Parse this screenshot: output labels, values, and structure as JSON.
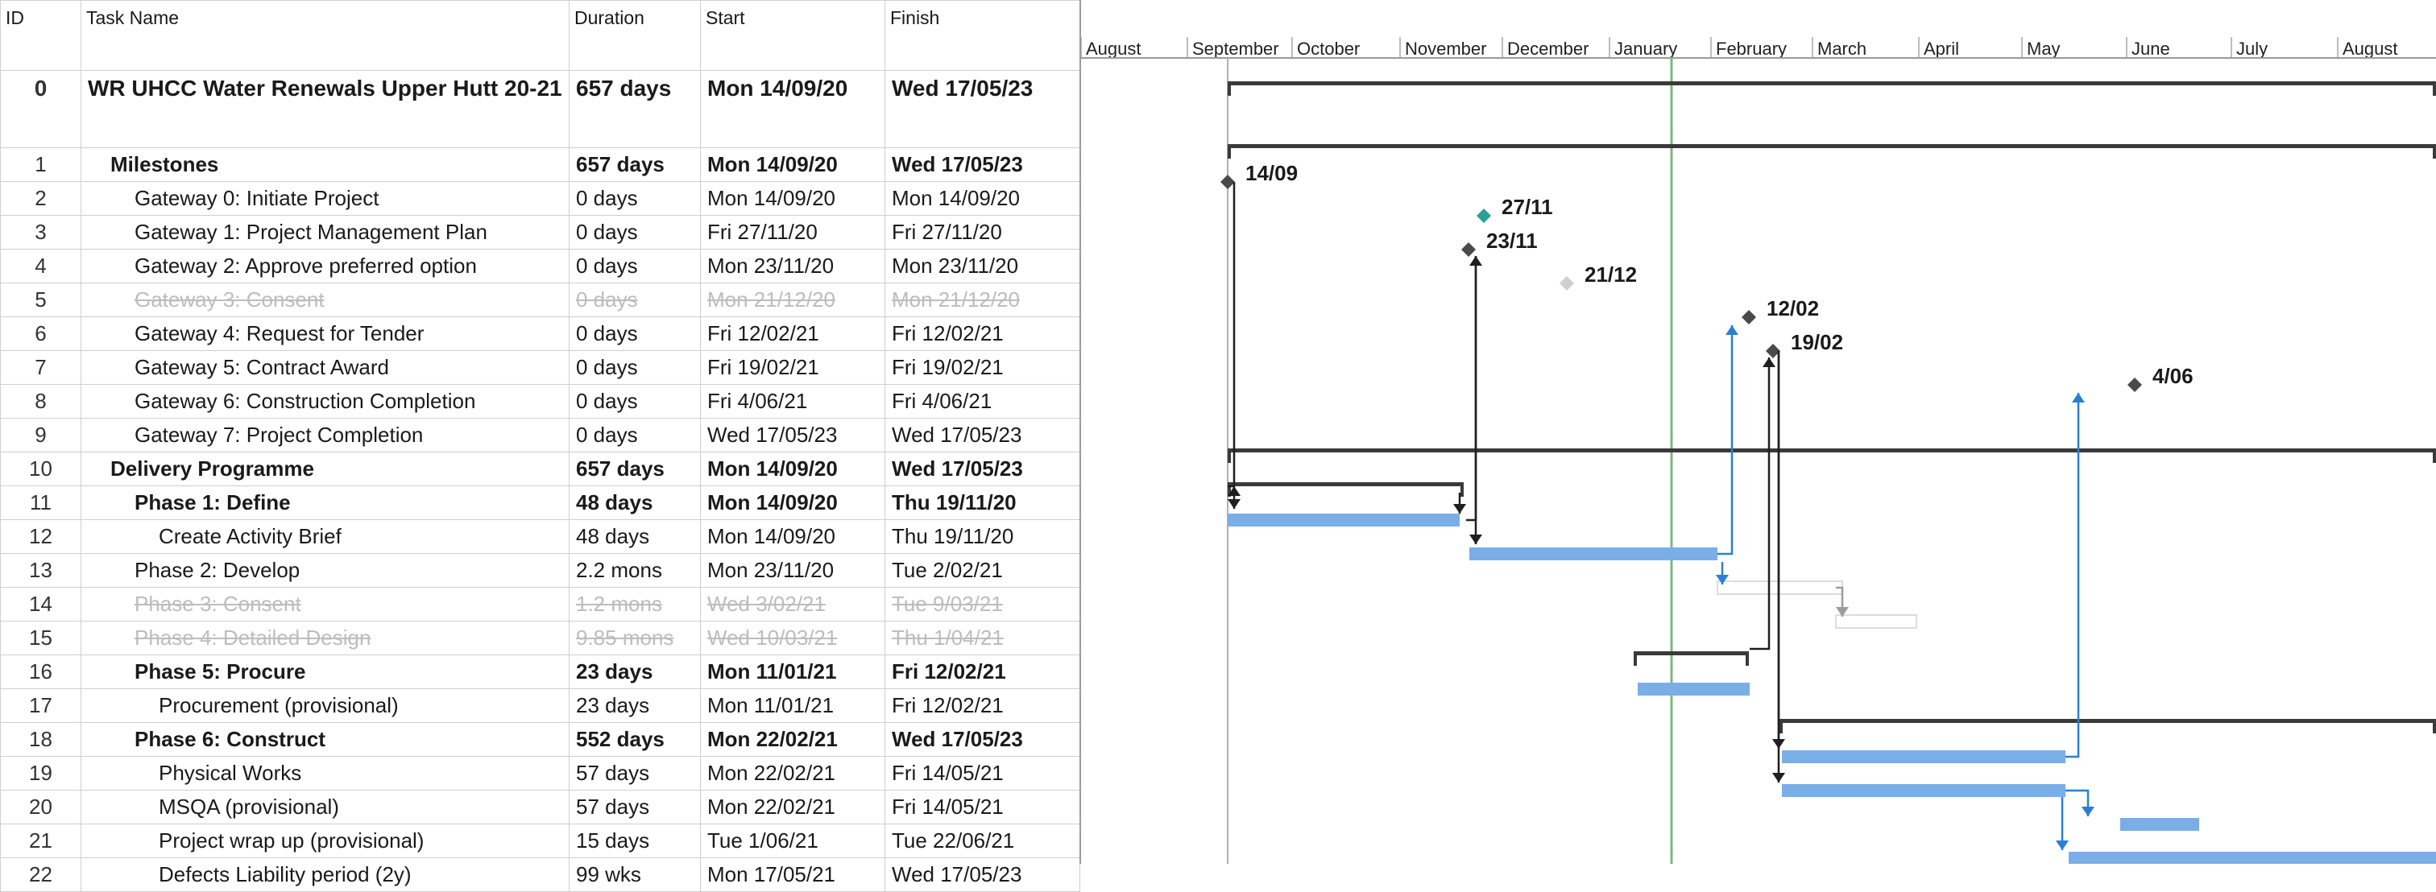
{
  "columns": {
    "id": "ID",
    "name": "Task Name",
    "duration": "Duration",
    "start": "Start",
    "finish": "Finish"
  },
  "timeline": {
    "months": [
      "August",
      "September",
      "October",
      "November",
      "December",
      "January",
      "February",
      "March",
      "April",
      "May",
      "June",
      "July",
      "August"
    ]
  },
  "tasks": [
    {
      "id": "0",
      "name": "WR UHCC Water Renewals Upper Hutt 20-21",
      "duration": "657 days",
      "start": "Mon 14/09/20",
      "finish": "Wed 17/05/23",
      "summary": true,
      "level": 0
    },
    {
      "id": "1",
      "name": "Milestones",
      "duration": "657 days",
      "start": "Mon 14/09/20",
      "finish": "Wed 17/05/23",
      "summary": true,
      "level": 1
    },
    {
      "id": "2",
      "name": "Gateway 0: Initiate Project",
      "duration": "0 days",
      "start": "Mon 14/09/20",
      "finish": "Mon 14/09/20",
      "level": 2,
      "milestone_label": "14/09"
    },
    {
      "id": "3",
      "name": "Gateway 1: Project Management Plan",
      "duration": "0 days",
      "start": "Fri 27/11/20",
      "finish": "Fri 27/11/20",
      "level": 2,
      "milestone_label": "27/11"
    },
    {
      "id": "4",
      "name": "Gateway 2: Approve preferred option",
      "duration": "0 days",
      "start": "Mon 23/11/20",
      "finish": "Mon 23/11/20",
      "level": 2,
      "milestone_label": "23/11"
    },
    {
      "id": "5",
      "name": "Gateway 3: Consent",
      "duration": "0 days",
      "start": "Mon 21/12/20",
      "finish": "Mon 21/12/20",
      "level": 2,
      "inactive": true,
      "milestone_label": "21/12"
    },
    {
      "id": "6",
      "name": "Gateway 4: Request for Tender",
      "duration": "0 days",
      "start": "Fri 12/02/21",
      "finish": "Fri 12/02/21",
      "level": 2,
      "milestone_label": "12/02"
    },
    {
      "id": "7",
      "name": "Gateway 5: Contract Award",
      "duration": "0 days",
      "start": "Fri 19/02/21",
      "finish": "Fri 19/02/21",
      "level": 2,
      "milestone_label": "19/02"
    },
    {
      "id": "8",
      "name": "Gateway 6: Construction Completion",
      "duration": "0 days",
      "start": "Fri 4/06/21",
      "finish": "Fri 4/06/21",
      "level": 2,
      "milestone_label": "4/06"
    },
    {
      "id": "9",
      "name": "Gateway 7: Project Completion",
      "duration": "0 days",
      "start": "Wed 17/05/23",
      "finish": "Wed 17/05/23",
      "level": 2
    },
    {
      "id": "10",
      "name": "Delivery Programme",
      "duration": "657 days",
      "start": "Mon 14/09/20",
      "finish": "Wed 17/05/23",
      "summary": true,
      "level": 1
    },
    {
      "id": "11",
      "name": "Phase 1: Define",
      "duration": "48 days",
      "start": "Mon 14/09/20",
      "finish": "Thu 19/11/20",
      "summary": true,
      "level": 2
    },
    {
      "id": "12",
      "name": "Create Activity Brief",
      "duration": "48 days",
      "start": "Mon 14/09/20",
      "finish": "Thu 19/11/20",
      "level": 3
    },
    {
      "id": "13",
      "name": "Phase 2: Develop",
      "duration": "2.2 mons",
      "start": "Mon 23/11/20",
      "finish": "Tue 2/02/21",
      "level": 2
    },
    {
      "id": "14",
      "name": "Phase 3: Consent",
      "duration": "1.2 mons",
      "start": "Wed 3/02/21",
      "finish": "Tue 9/03/21",
      "level": 2,
      "inactive": true
    },
    {
      "id": "15",
      "name": "Phase 4: Detailed Design",
      "duration": "9.85 mons",
      "start": "Wed 10/03/21",
      "finish": "Thu 1/04/21",
      "level": 2,
      "inactive": true
    },
    {
      "id": "16",
      "name": "Phase 5: Procure",
      "duration": "23 days",
      "start": "Mon 11/01/21",
      "finish": "Fri 12/02/21",
      "summary": true,
      "level": 2
    },
    {
      "id": "17",
      "name": "Procurement (provisional)",
      "duration": "23 days",
      "start": "Mon 11/01/21",
      "finish": "Fri 12/02/21",
      "level": 3
    },
    {
      "id": "18",
      "name": "Phase 6: Construct",
      "duration": "552 days",
      "start": "Mon 22/02/21",
      "finish": "Wed 17/05/23",
      "summary": true,
      "level": 2
    },
    {
      "id": "19",
      "name": "Physical Works",
      "duration": "57 days",
      "start": "Mon 22/02/21",
      "finish": "Fri 14/05/21",
      "level": 3
    },
    {
      "id": "20",
      "name": "MSQA (provisional)",
      "duration": "57 days",
      "start": "Mon 22/02/21",
      "finish": "Fri 14/05/21",
      "level": 3
    },
    {
      "id": "21",
      "name": "Project wrap up (provisional)",
      "duration": "15 days",
      "start": "Tue 1/06/21",
      "finish": "Tue 22/06/21",
      "level": 3
    },
    {
      "id": "22",
      "name": "Defects Liability period (2y)",
      "duration": "99 wks",
      "start": "Mon 17/05/21",
      "finish": "Wed 17/05/23",
      "level": 3
    }
  ],
  "colors": {
    "task_bar": "#7aaee6",
    "summary_bar": "#3a3a3a",
    "milestone": "#4a4a4a",
    "milestone_highlight": "#2aa198",
    "today_line": "#7cb87c",
    "link": "#2a7fd4"
  },
  "icons": {
    "milestone": "diamond-icon"
  }
}
